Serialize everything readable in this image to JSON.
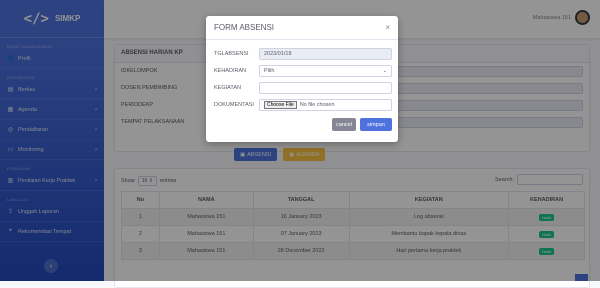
{
  "brand": {
    "name": "SIMKP",
    "logo": "</>"
  },
  "sidebar": {
    "heading_1": "HOME MANAGEMENT",
    "heading_2": "DASHBOARD",
    "heading_3": "PENILAIAN",
    "heading_4": "LAIN-LAIN",
    "items": [
      {
        "label": "Profil",
        "icon": "user-icon"
      },
      {
        "label": "Berkas",
        "icon": "file-icon"
      },
      {
        "label": "Agenda",
        "icon": "calendar-icon"
      },
      {
        "label": "Pendaftaran",
        "icon": "clipboard-icon"
      },
      {
        "label": "Monitoring",
        "icon": "monitor-icon"
      },
      {
        "label": "Penilaian Kerja Praktek",
        "icon": "chart-icon"
      },
      {
        "label": "Unggah Laporan",
        "icon": "upload-icon"
      },
      {
        "label": "Rekomendasi Tempat",
        "icon": "map-icon"
      }
    ],
    "toggle_icon": "‹"
  },
  "topbar": {
    "user_name": "Mahasiswa 151"
  },
  "page": {
    "card_title": "ABSENSI HARIAN KP",
    "fields": [
      "IDKELOMPOK",
      "DOSEN PEMBIMBING",
      "PERIODEKP",
      "TEMPAT PELAKSANAAN"
    ],
    "btn_absensi": "ABSENSI",
    "btn_agenda": "AGENDA"
  },
  "table": {
    "show_label": "Show",
    "show_value": "10",
    "entries_label": "entries",
    "search_label": "Search:",
    "columns": [
      "No",
      "NAMA",
      "TANGGAL",
      "KEGIATAN",
      "KEHADIRAN"
    ],
    "rows": [
      {
        "no": "1",
        "nama": "Mahasiswa 151",
        "tanggal": "16 January 2023",
        "kegiatan": "Log absensi",
        "kehadiran": "Hadir"
      },
      {
        "no": "2",
        "nama": "Mahasiswa 151",
        "tanggal": "07 January 2023",
        "kegiatan": "Membantu bapak kepala dinas",
        "kehadiran": "Hadir"
      },
      {
        "no": "3",
        "nama": "Mahasiswa 151",
        "tanggal": "28 December 2022",
        "kegiatan": "Hari pertama kerja praktek",
        "kehadiran": "Hadir"
      }
    ]
  },
  "modal": {
    "title": "FORM ABSENSI",
    "close": "×",
    "tgl_label": "TGLABSENSI",
    "tgl_value": "2023/01/18",
    "kehadiran_label": "KEHADIRAN",
    "kehadiran_value": "Pilih",
    "kegiatan_label": "KEGIATAN",
    "kegiatan_value": "",
    "dokumentasi_label": "DOKUMENTASI",
    "choose_file": "Choose File",
    "no_file": "No file chosen",
    "cancel": "cancel",
    "simpan": "simpan"
  },
  "colors": {
    "primary": "#4e73df",
    "success": "#1cc88a",
    "warning": "#f6c23e",
    "secondary": "#858796"
  }
}
